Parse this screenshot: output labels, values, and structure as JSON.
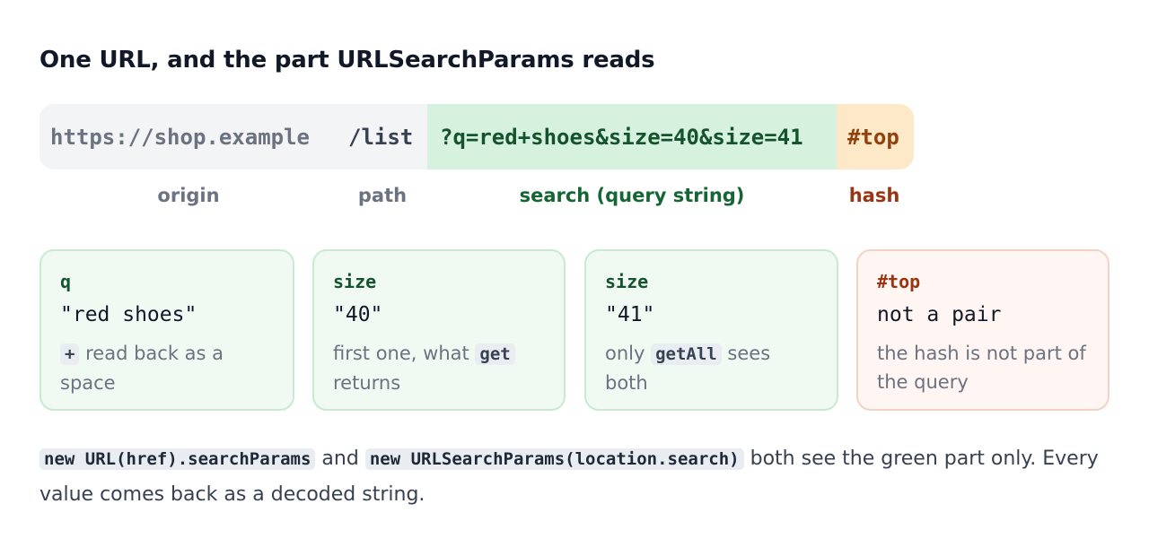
{
  "title": "One URL, and the part URLSearchParams reads",
  "url": {
    "origin": "https://shop.example",
    "path": "/list",
    "search": "?q=red+shoes&size=40&size=41",
    "hash": "#top"
  },
  "labels": {
    "origin": "origin",
    "path": "path",
    "search": "search (query string)",
    "hash": "hash"
  },
  "cards": [
    {
      "key": "q",
      "value": "\"red shoes\"",
      "note_code": "+",
      "note_after": " read back as a space"
    },
    {
      "key": "size",
      "value": "\"40\"",
      "note_before": "first one, what ",
      "note_code": "get",
      "note_after": " returns"
    },
    {
      "key": "size",
      "value": "\"41\"",
      "note_before": "only ",
      "note_code": "getAll",
      "note_after": " sees both"
    },
    {
      "key": "#top",
      "value": "not a pair",
      "note_before": "the hash is not part of the query"
    }
  ],
  "footer": {
    "code1": "new URL(href).searchParams",
    "text1": " and ",
    "code2": "new URLSearchParams(location.search)",
    "text2": " both see the green part only. Every value comes back as a decoded string."
  },
  "colors": {
    "search_bg": "#d6f2de",
    "hash_bg": "#fde9c7",
    "neutral_bg": "#f3f4f6"
  }
}
